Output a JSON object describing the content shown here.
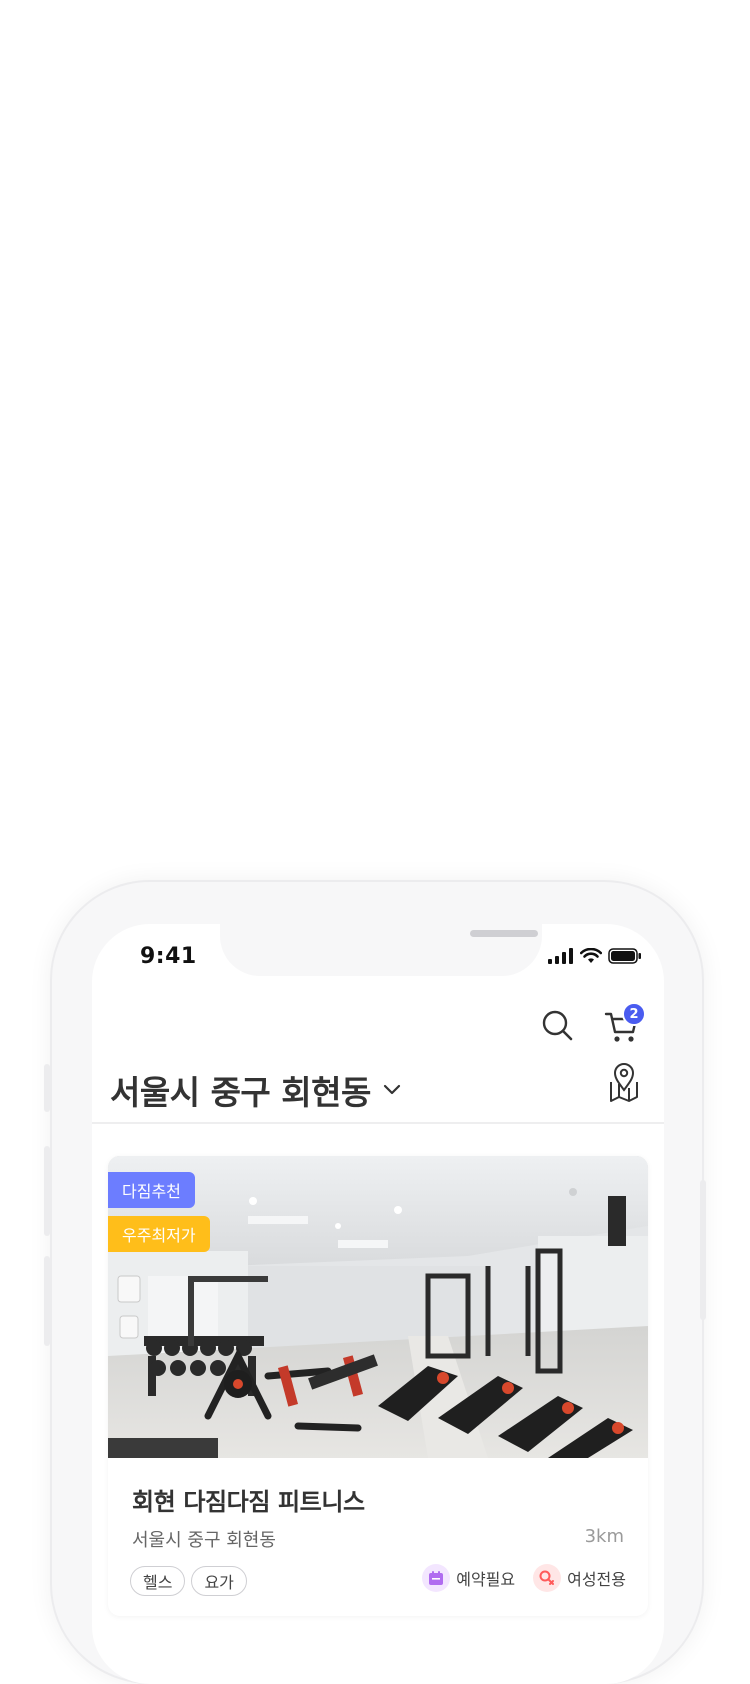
{
  "status_bar": {
    "time": "9:41"
  },
  "header": {
    "cart_count": "2",
    "location": "서울시 중구 회현동"
  },
  "card": {
    "badges": [
      "다짐추천",
      "우주최저가"
    ],
    "name": "회현 다짐다짐 피트니스",
    "address": "서울시 중구 회현동",
    "distance": "3km",
    "tags": [
      "헬스",
      "요가"
    ],
    "features": [
      {
        "label": "예약필요",
        "icon": "calendar-icon",
        "color": "#b06cf0"
      },
      {
        "label": "여성전용",
        "icon": "female-icon",
        "color": "#ff5a5a"
      }
    ]
  },
  "colors": {
    "accent": "#4a5cf0",
    "badge_recommend": "#6c7dff",
    "badge_lowest": "#ffbe1a"
  }
}
